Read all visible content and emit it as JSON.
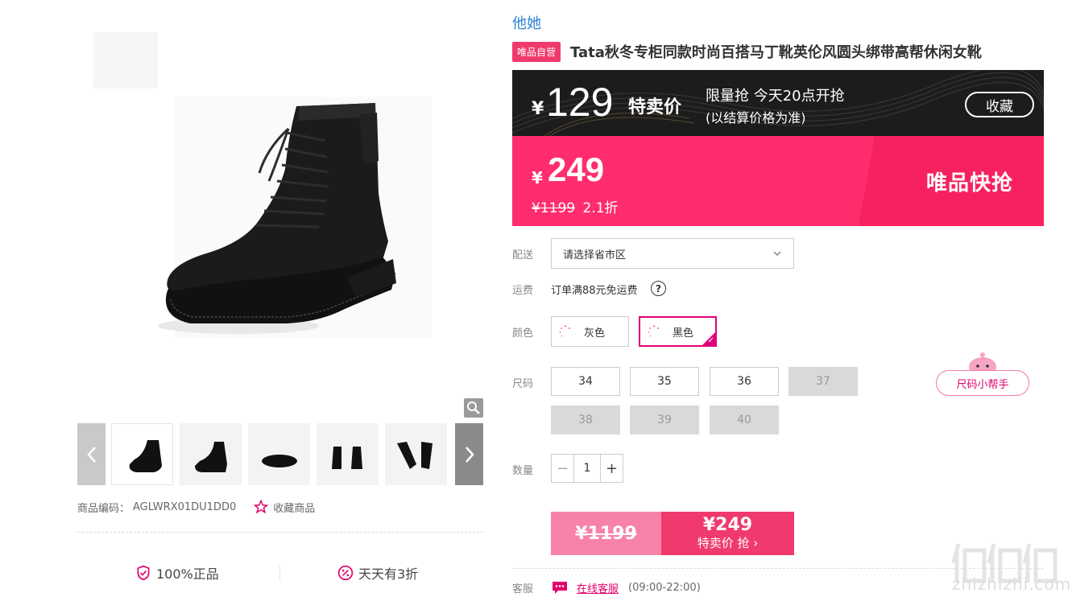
{
  "gallery": {
    "thumbnails": [
      "boot-side",
      "boot-side-2",
      "boot-sole",
      "boot-front",
      "boot-pair",
      "boot-partial"
    ],
    "product_code_label": "商品编码：",
    "product_code": "AGLWRX01DU1DD0",
    "favorite_label": "收藏商品",
    "guarantee_authentic": "100%正品",
    "guarantee_discount": "天天有3折"
  },
  "product": {
    "brand": "他她",
    "self_badge": "唯品自营",
    "title": "Tata秋冬专柜同款时尚百搭马丁靴英伦风圆头绑带高帮休闲女靴"
  },
  "flash_price": {
    "currency": "¥",
    "price": "129",
    "label": "特卖价",
    "promo_line1": "限量抢 今天20点开抢",
    "promo_line2": "(以结算价格为准)",
    "collect_button": "收藏"
  },
  "sale_price": {
    "currency": "¥",
    "price": "249",
    "original": "¥1199",
    "discount": "2.1折",
    "label": "唯品快抢"
  },
  "options": {
    "delivery_label": "配送",
    "region_placeholder": "请选择省市区",
    "shipping_label": "运费",
    "shipping_text": "订单满88元免运费",
    "help_icon": "?",
    "color_label": "颜色",
    "colors": [
      {
        "name": "灰色",
        "selected": false
      },
      {
        "name": "黑色",
        "selected": true
      }
    ],
    "size_label": "尺码",
    "sizes": [
      {
        "value": "34",
        "available": true
      },
      {
        "value": "35",
        "available": true
      },
      {
        "value": "36",
        "available": true
      },
      {
        "value": "37",
        "available": false
      },
      {
        "value": "38",
        "available": false
      },
      {
        "value": "39",
        "available": false
      },
      {
        "value": "40",
        "available": false
      }
    ],
    "size_helper": "尺码小帮手",
    "quantity_label": "数量",
    "quantity": "1",
    "minus": "−",
    "plus": "+"
  },
  "buy": {
    "original": "¥1199",
    "price": "¥249",
    "label": "特卖价 抢 ›"
  },
  "service": {
    "label": "客服",
    "link": "在线客服",
    "hours": "(09:00-22:00)"
  },
  "watermark": "zhizhizhi.com",
  "colors": {
    "accent": "#f03a6d",
    "flash_bg": "#1c1c1c",
    "sale_bg": "#ff2d6d",
    "brand_blue": "#2b7fd0"
  }
}
